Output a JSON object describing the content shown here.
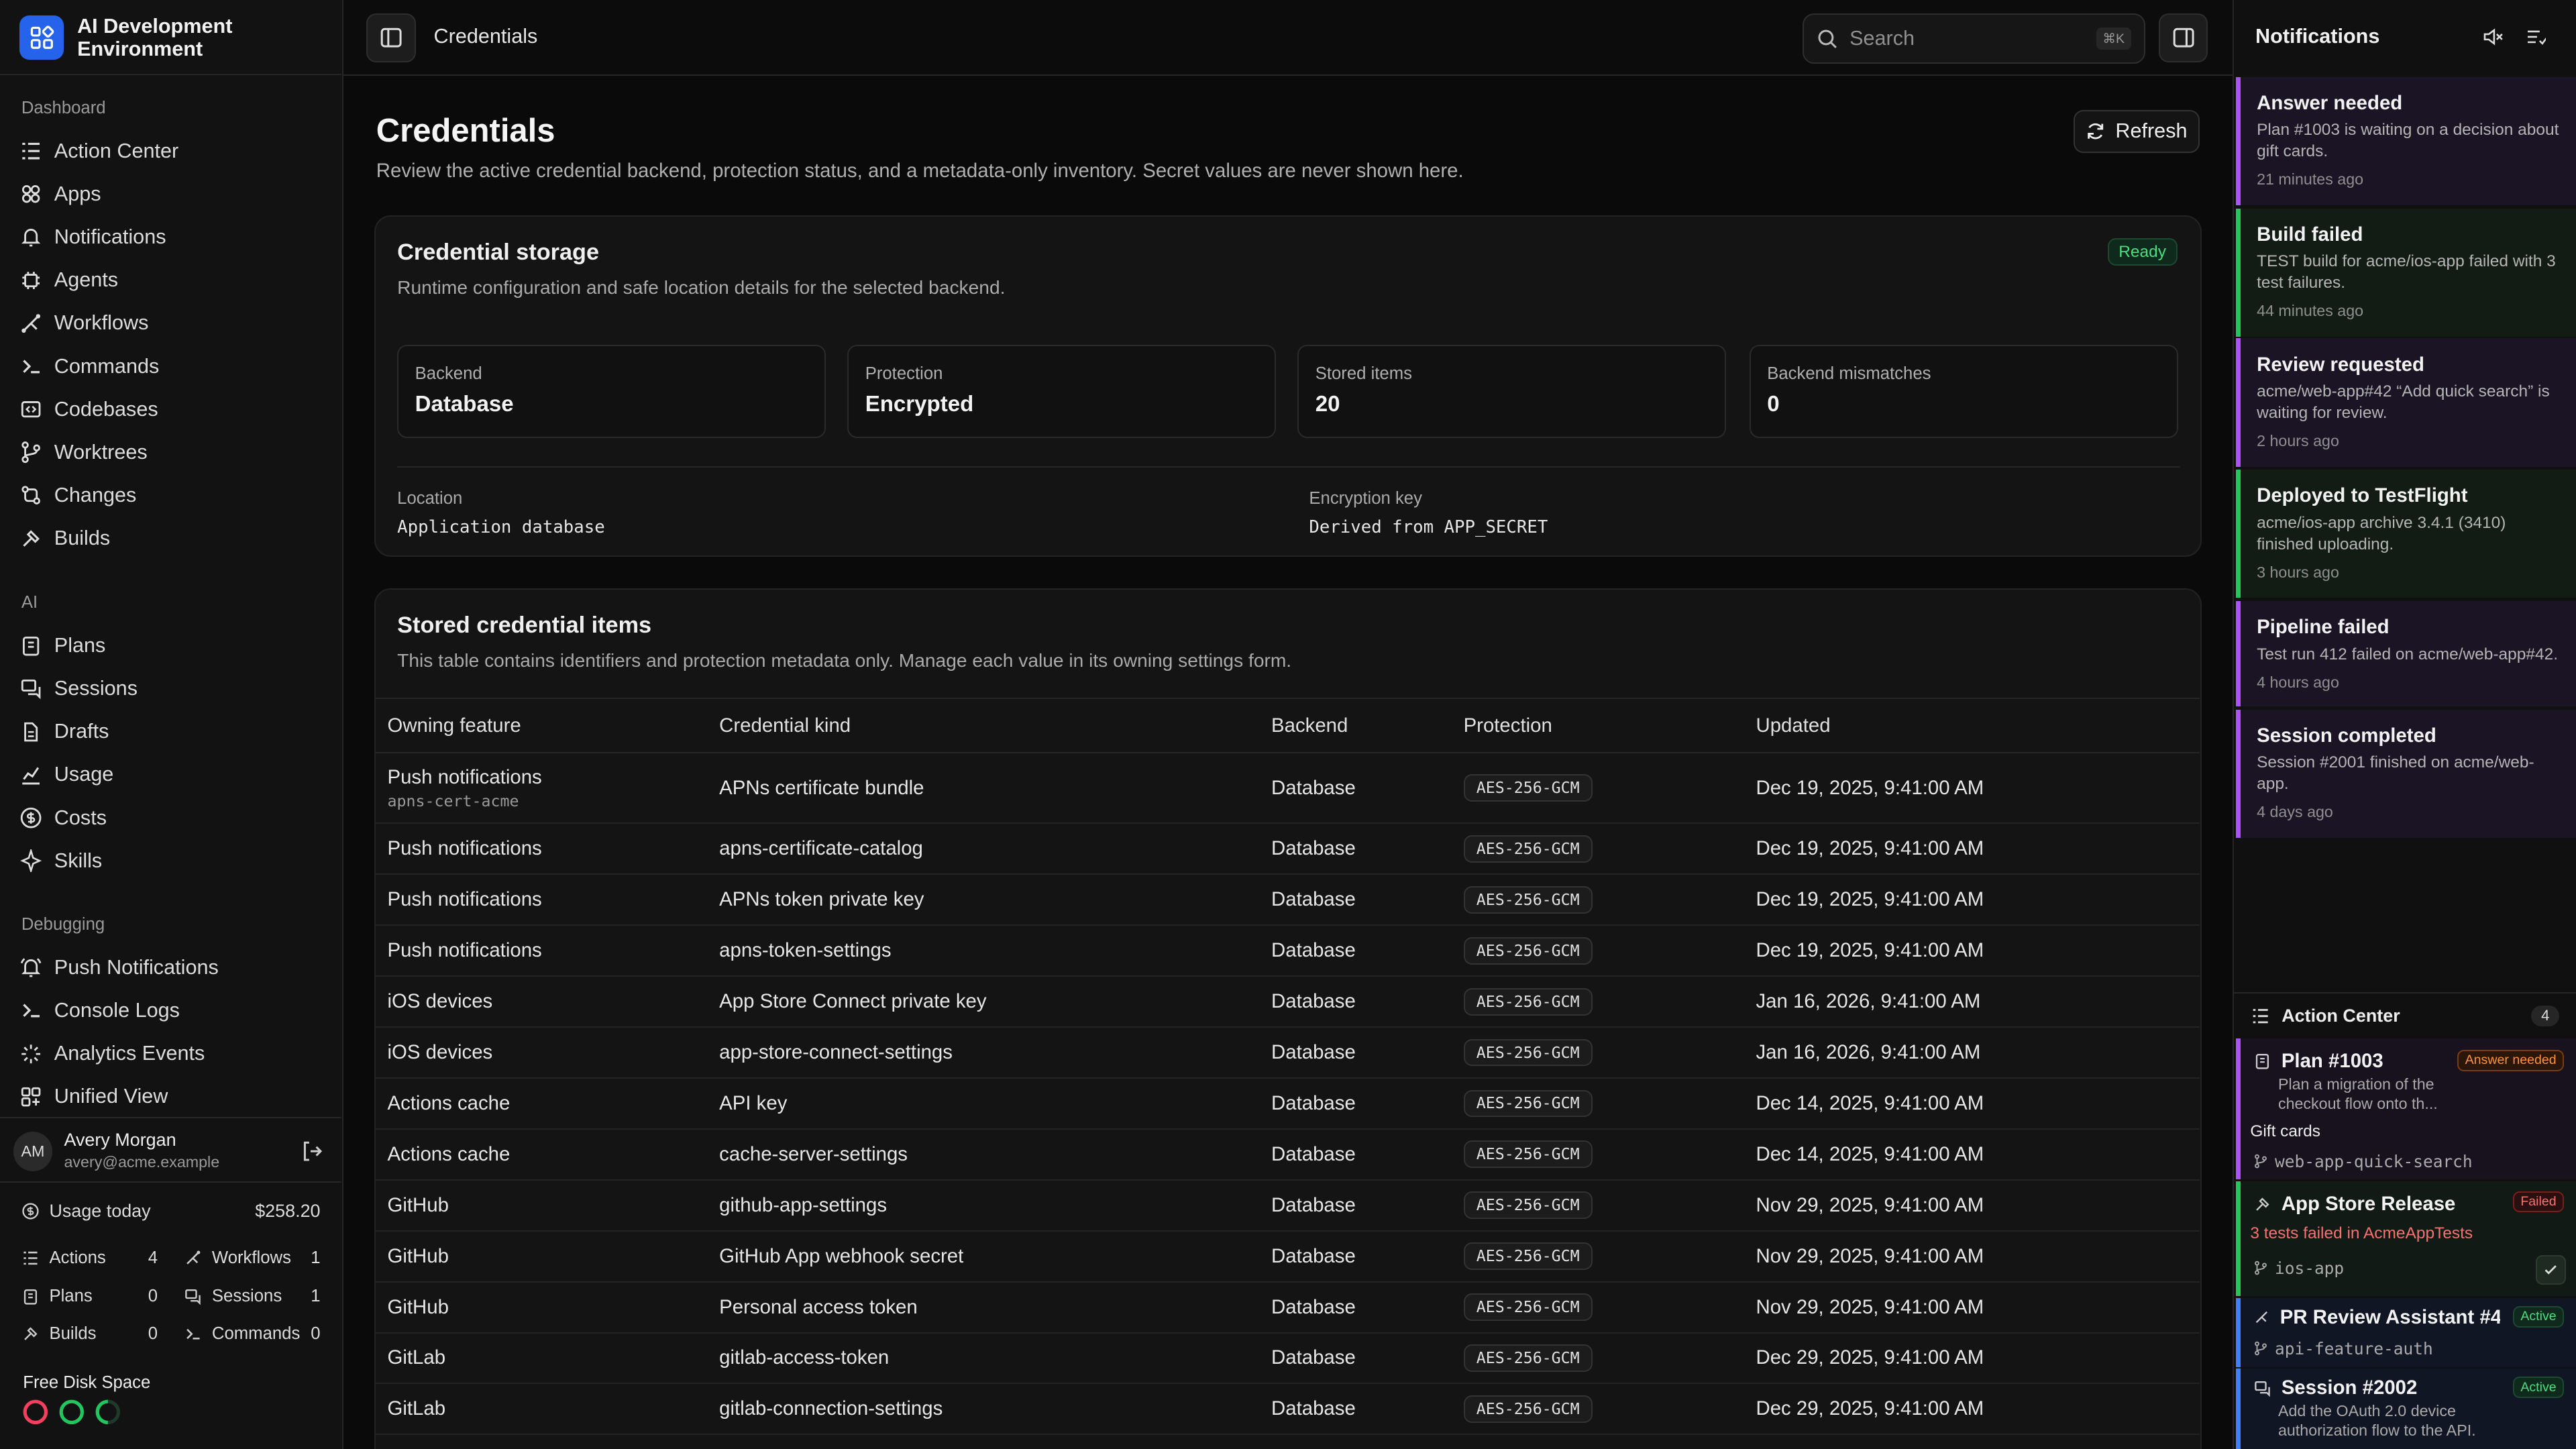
{
  "app": {
    "title": "AI Development Environment"
  },
  "sidebar": {
    "sections": {
      "dashboard": "Dashboard",
      "ai": "AI",
      "debugging": "Debugging"
    },
    "dashboard_items": [
      {
        "label": "Action Center",
        "icon": "list-check-icon"
      },
      {
        "label": "Apps",
        "icon": "apps-icon"
      },
      {
        "label": "Notifications",
        "icon": "bell-icon"
      },
      {
        "label": "Agents",
        "icon": "cpu-icon"
      },
      {
        "label": "Workflows",
        "icon": "workflow-icon"
      },
      {
        "label": "Commands",
        "icon": "terminal-icon"
      },
      {
        "label": "Codebases",
        "icon": "codebase-icon"
      },
      {
        "label": "Worktrees",
        "icon": "git-branch-icon"
      },
      {
        "label": "Changes",
        "icon": "git-compare-icon"
      },
      {
        "label": "Builds",
        "icon": "hammer-icon"
      }
    ],
    "ai_items": [
      {
        "label": "Plans",
        "icon": "clipboard-icon"
      },
      {
        "label": "Sessions",
        "icon": "chat-icon"
      },
      {
        "label": "Drafts",
        "icon": "file-icon"
      },
      {
        "label": "Usage",
        "icon": "chart-icon"
      },
      {
        "label": "Costs",
        "icon": "dollar-icon"
      },
      {
        "label": "Skills",
        "icon": "sparkle-icon"
      }
    ],
    "debugging_items": [
      {
        "label": "Push Notifications",
        "icon": "bell-ring-icon"
      },
      {
        "label": "Console Logs",
        "icon": "terminal-icon"
      },
      {
        "label": "Analytics Events",
        "icon": "activity-icon"
      },
      {
        "label": "Unified View",
        "icon": "grid-icon"
      }
    ],
    "user": {
      "initials": "AM",
      "name": "Avery Morgan",
      "email": "avery@acme.example"
    },
    "usage": {
      "label": "Usage today",
      "amount": "$258.20"
    },
    "stats": {
      "actions": {
        "label": "Actions",
        "value": "4"
      },
      "workflows": {
        "label": "Workflows",
        "value": "1"
      },
      "plans": {
        "label": "Plans",
        "value": "0"
      },
      "sessions": {
        "label": "Sessions",
        "value": "1"
      },
      "builds": {
        "label": "Builds",
        "value": "0"
      },
      "commands": {
        "label": "Commands",
        "value": "0"
      }
    },
    "disk": {
      "label": "Free Disk Space"
    }
  },
  "topbar": {
    "breadcrumb": "Credentials",
    "search_placeholder": "Search",
    "search_shortcut": "⌘K"
  },
  "page": {
    "title": "Credentials",
    "subtitle": "Review the active credential backend, protection status, and a metadata-only inventory. Secret values are never shown here.",
    "refresh_label": "Refresh"
  },
  "storage": {
    "title": "Credential storage",
    "subtitle": "Runtime configuration and safe location details for the selected backend.",
    "status": "Ready",
    "metrics": [
      {
        "label": "Backend",
        "value": "Database"
      },
      {
        "label": "Protection",
        "value": "Encrypted"
      },
      {
        "label": "Stored items",
        "value": "20"
      },
      {
        "label": "Backend mismatches",
        "value": "0"
      }
    ],
    "location_label": "Location",
    "location_value": "Application database",
    "key_label": "Encryption key",
    "key_value": "Derived from APP_SECRET"
  },
  "items": {
    "title": "Stored credential items",
    "subtitle": "This table contains identifiers and protection metadata only. Manage each value in its owning settings form.",
    "columns": [
      "Owning feature",
      "Credential kind",
      "Backend",
      "Protection",
      "Updated"
    ],
    "rows": [
      {
        "feature": "Push notifications",
        "sub": "apns-cert-acme",
        "kind": "APNs certificate bundle",
        "backend": "Database",
        "protection": "AES-256-GCM",
        "updated": "Dec 19, 2025, 9:41:00 AM"
      },
      {
        "feature": "Push notifications",
        "sub": "",
        "kind": "apns-certificate-catalog",
        "backend": "Database",
        "protection": "AES-256-GCM",
        "updated": "Dec 19, 2025, 9:41:00 AM"
      },
      {
        "feature": "Push notifications",
        "sub": "",
        "kind": "APNs token private key",
        "backend": "Database",
        "protection": "AES-256-GCM",
        "updated": "Dec 19, 2025, 9:41:00 AM"
      },
      {
        "feature": "Push notifications",
        "sub": "",
        "kind": "apns-token-settings",
        "backend": "Database",
        "protection": "AES-256-GCM",
        "updated": "Dec 19, 2025, 9:41:00 AM"
      },
      {
        "feature": "iOS devices",
        "sub": "",
        "kind": "App Store Connect private key",
        "backend": "Database",
        "protection": "AES-256-GCM",
        "updated": "Jan 16, 2026, 9:41:00 AM"
      },
      {
        "feature": "iOS devices",
        "sub": "",
        "kind": "app-store-connect-settings",
        "backend": "Database",
        "protection": "AES-256-GCM",
        "updated": "Jan 16, 2026, 9:41:00 AM"
      },
      {
        "feature": "Actions cache",
        "sub": "",
        "kind": "API key",
        "backend": "Database",
        "protection": "AES-256-GCM",
        "updated": "Dec 14, 2025, 9:41:00 AM"
      },
      {
        "feature": "Actions cache",
        "sub": "",
        "kind": "cache-server-settings",
        "backend": "Database",
        "protection": "AES-256-GCM",
        "updated": "Dec 14, 2025, 9:41:00 AM"
      },
      {
        "feature": "GitHub",
        "sub": "",
        "kind": "github-app-settings",
        "backend": "Database",
        "protection": "AES-256-GCM",
        "updated": "Nov 29, 2025, 9:41:00 AM"
      },
      {
        "feature": "GitHub",
        "sub": "",
        "kind": "GitHub App webhook secret",
        "backend": "Database",
        "protection": "AES-256-GCM",
        "updated": "Nov 29, 2025, 9:41:00 AM"
      },
      {
        "feature": "GitHub",
        "sub": "",
        "kind": "Personal access token",
        "backend": "Database",
        "protection": "AES-256-GCM",
        "updated": "Nov 29, 2025, 9:41:00 AM"
      },
      {
        "feature": "GitLab",
        "sub": "",
        "kind": "gitlab-access-token",
        "backend": "Database",
        "protection": "AES-256-GCM",
        "updated": "Dec 29, 2025, 9:41:00 AM"
      },
      {
        "feature": "GitLab",
        "sub": "",
        "kind": "gitlab-connection-settings",
        "backend": "Database",
        "protection": "AES-256-GCM",
        "updated": "Dec 29, 2025, 9:41:00 AM"
      }
    ]
  },
  "notifications": {
    "title": "Notifications",
    "items": [
      {
        "title": "Answer needed",
        "body": "Plan #1003 is waiting on a decision about gift cards.",
        "time": "21 minutes ago",
        "color": "#a855f7",
        "bg": "#1b1424"
      },
      {
        "title": "Build failed",
        "body": "TEST build for acme/ios-app failed with 3 test failures.",
        "time": "44 minutes ago",
        "color": "#22c55e",
        "bg": "#121c15"
      },
      {
        "title": "Review requested",
        "body": "acme/web-app#42 “Add quick search” is waiting for review.",
        "time": "2 hours ago",
        "color": "#a855f7",
        "bg": "#1b1424"
      },
      {
        "title": "Deployed to TestFlight",
        "body": "acme/ios-app archive 3.4.1 (3410) finished uploading.",
        "time": "3 hours ago",
        "color": "#22c55e",
        "bg": "#121c15"
      },
      {
        "title": "Pipeline failed",
        "body": "Test run 412 failed on acme/web-app#42.",
        "time": "4 hours ago",
        "color": "#a855f7",
        "bg": "#1b1424"
      },
      {
        "title": "Session completed",
        "body": "Session #2001 finished on acme/web-app.",
        "time": "4 days ago",
        "color": "#a855f7",
        "bg": "#1b1424"
      }
    ]
  },
  "action_center": {
    "title": "Action Center",
    "count": "4",
    "items": [
      {
        "title": "Plan #1003",
        "desc": "Plan a migration of the checkout flow onto th...",
        "badge": "Answer needed",
        "extra": "Gift cards",
        "branch": "web-app-quick-search"
      },
      {
        "title": "App Store Release",
        "error": "3 tests failed in AcmeAppTests",
        "badge": "Failed",
        "branch": "ios-app"
      },
      {
        "title": "PR Review Assistant #4...",
        "badge": "Active",
        "branch": "api-feature-auth"
      },
      {
        "title": "Session #2002",
        "desc": "Add the OAuth 2.0 device authorization flow to the API.",
        "badge": "Active"
      }
    ]
  }
}
